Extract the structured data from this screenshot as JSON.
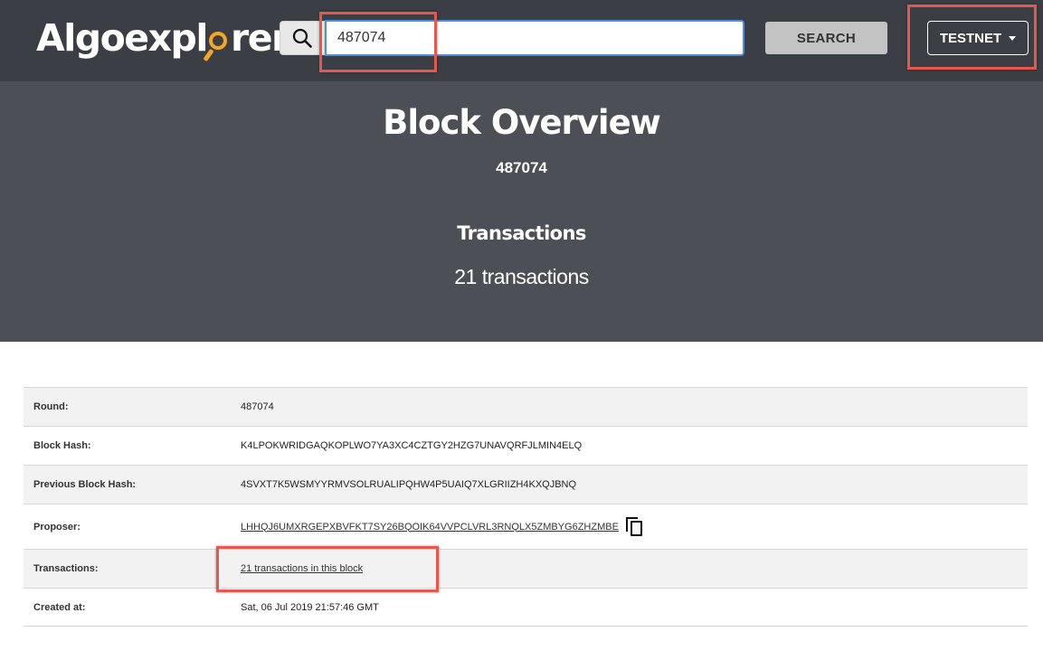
{
  "header": {
    "logo_prefix": "Algoexpl",
    "logo_suffix": "rer",
    "search_value": "487074",
    "search_button_label": "SEARCH",
    "network_label": "TESTNET"
  },
  "hero": {
    "title": "Block Overview",
    "round": "487074",
    "transactions_title": "Transactions",
    "transactions_count": "21 transactions"
  },
  "details": {
    "round": {
      "label": "Round:",
      "value": "487074"
    },
    "block_hash": {
      "label": "Block Hash:",
      "value": "K4LPOKWRIDGAQKOPLWO7YA3XC4CZTGY2HZG7UNAVQRFJLMIN4ELQ"
    },
    "previous_block_hash": {
      "label": "Previous Block Hash:",
      "value": "4SVXT7K5WSMYYRMVSOLRUALIPQHW4P5UAIQ7XLGRIIZH4KXQJBNQ"
    },
    "proposer": {
      "label": "Proposer:",
      "value": "LHHQJ6UMXRGEPXBVFKT7SY26BQOIK64VVPCLVRL3RNQLX5ZMBYG6ZHZMBE"
    },
    "transactions": {
      "label": "Transactions:",
      "value": "21 transactions in this block"
    },
    "created_at": {
      "label": "Created at:",
      "value": "Sat, 06 Jul 2019 21:57:46 GMT"
    }
  },
  "icons": {
    "search": "search-icon",
    "copy": "copy-icon",
    "dropdown": "caret-down-icon",
    "logo_lens": "magnifier-icon"
  },
  "colors": {
    "header_bg": "#3b3e44",
    "hero_bg": "#4c4f55",
    "accent": "#f5a623",
    "highlight": "#e8574b",
    "input_border": "#4a90e2"
  }
}
